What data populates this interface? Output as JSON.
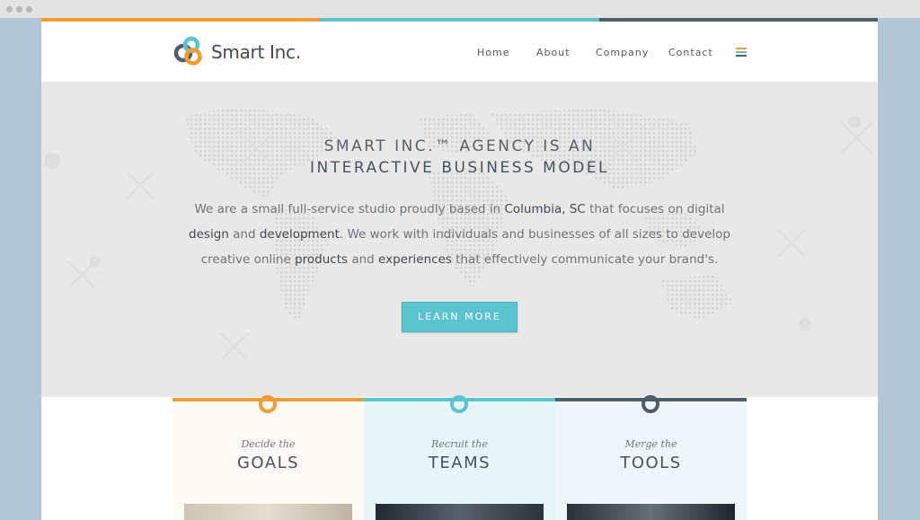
{
  "brand": {
    "name": "Smart Inc."
  },
  "nav": {
    "items": [
      {
        "label": "Home"
      },
      {
        "label": "About"
      },
      {
        "label": "Company"
      },
      {
        "label": "Contact"
      }
    ]
  },
  "colors": {
    "orange": "#f39c32",
    "teal": "#5bc3cf",
    "slate": "#4f5d6b"
  },
  "hero": {
    "title_line1": "SMART INC.™ AGENCY IS AN",
    "title_line2": "INTERACTIVE BUSINESS MODEL",
    "para": [
      "We are a small full-service studio proudly based in ",
      "Columbia, SC",
      " that focuses on digital ",
      "design",
      " and ",
      "development",
      ". We work with individuals and businesses of all sizes to develop creative online ",
      "products",
      " and ",
      "experiences",
      " that effectively communicate your brand's."
    ],
    "button_label": "LEARN MORE"
  },
  "cards": [
    {
      "subtitle": "Decide the",
      "title": "GOALS"
    },
    {
      "subtitle": "Recruit the",
      "title": "TEAMS"
    },
    {
      "subtitle": "Merge the",
      "title": "TOOLS"
    }
  ]
}
